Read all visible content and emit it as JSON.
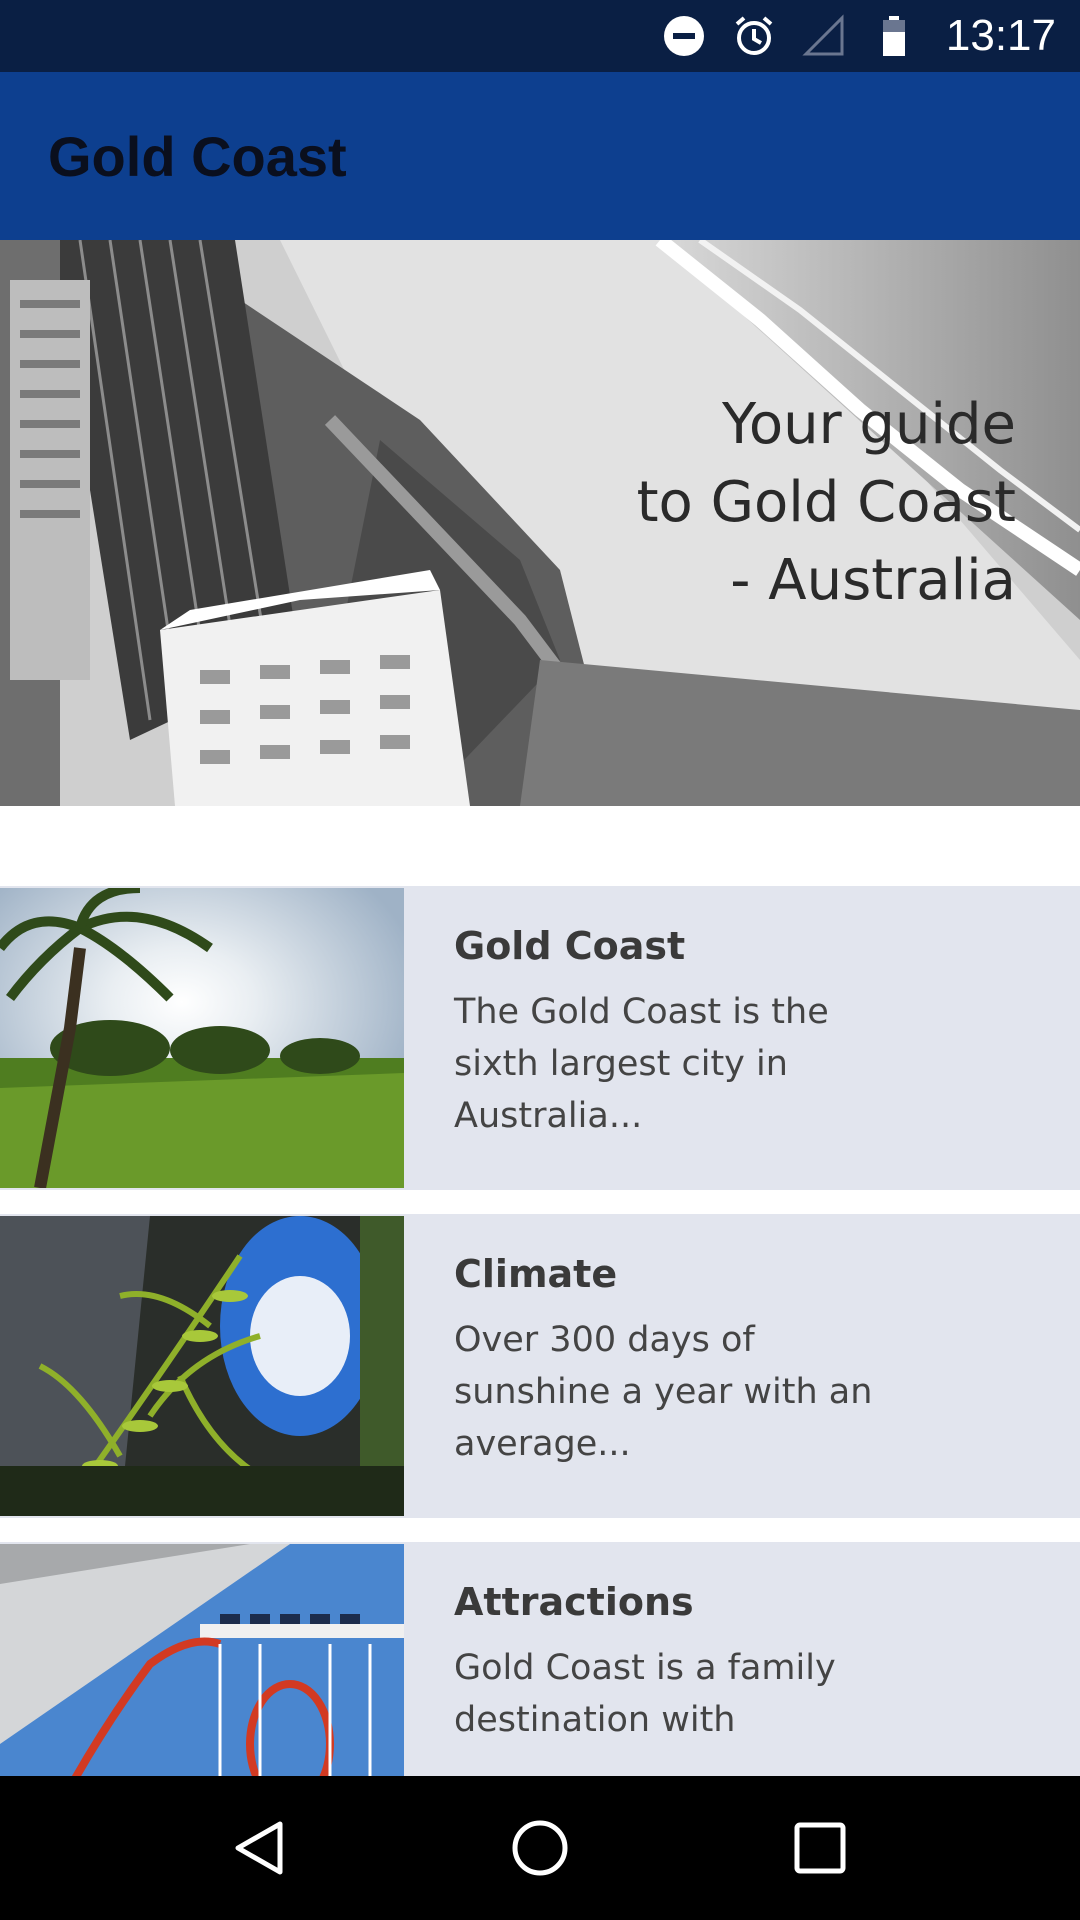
{
  "status_bar": {
    "time": "13:17",
    "icons": [
      "do-not-disturb-icon",
      "alarm-icon",
      "signal-icon",
      "battery-icon"
    ]
  },
  "app_bar": {
    "title": "Gold Coast",
    "color": "#0d3f8f"
  },
  "hero": {
    "tagline": "Your guide\nto Gold Coast\n- Australia"
  },
  "cards": [
    {
      "title": "Gold Coast",
      "description": "The Gold Coast is the sixth largest city in Australia..."
    },
    {
      "title": "Climate",
      "description": "Over 300 days of sunshine a year with an average..."
    },
    {
      "title": "Attractions",
      "description": "Gold Coast is a family destination with"
    }
  ],
  "nav_bar": {
    "icons": [
      "back-icon",
      "home-icon",
      "recents-icon"
    ]
  },
  "colors": {
    "status_bar": "#0a1f44",
    "card_background": "#e2e5ee",
    "nav_bar": "#000000"
  }
}
